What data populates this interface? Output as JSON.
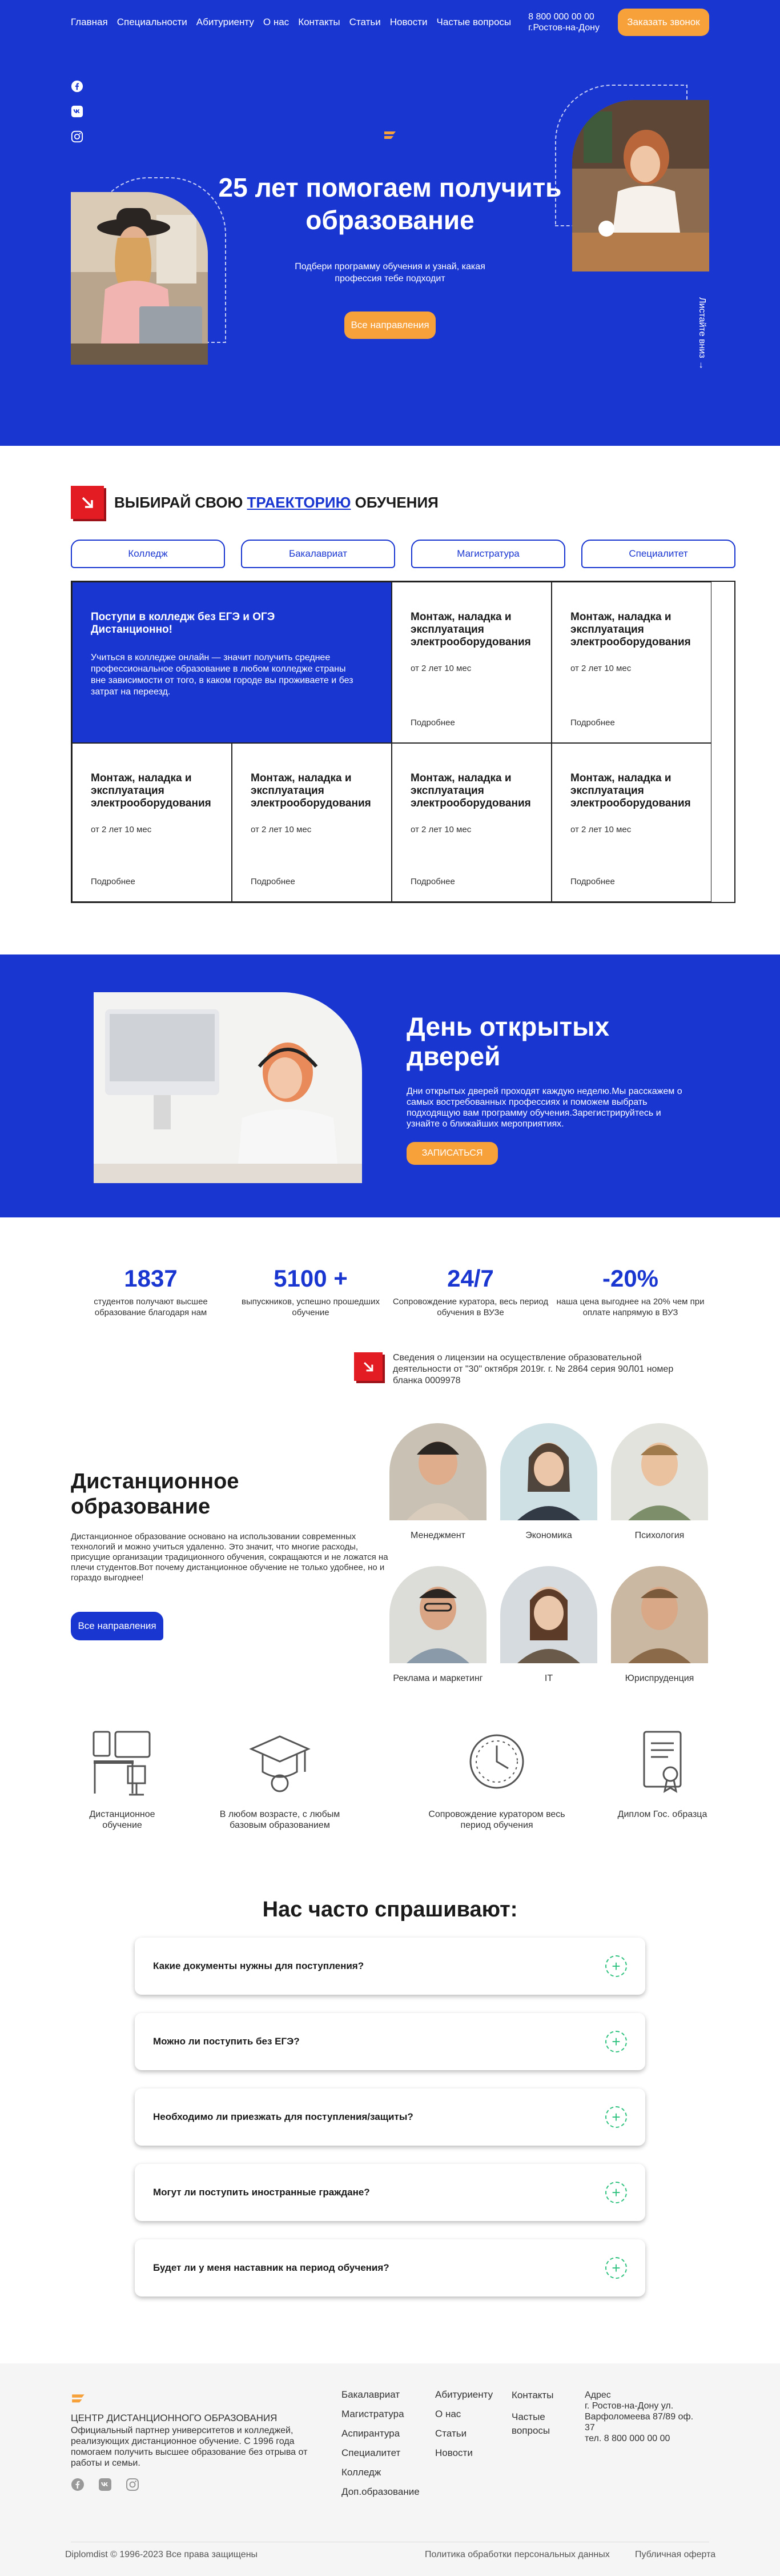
{
  "nav": {
    "links": [
      "Главная",
      "Специальности",
      "Абитуриенту",
      "О нас",
      "Контакты",
      "Статьи",
      "Новости",
      "Частые вопросы"
    ],
    "phone": "8 800 000 00 00",
    "city": "г.Ростов-на-Дону",
    "callback_label": "Заказать звонок"
  },
  "hero": {
    "title": "25 лет помогаем получить образование",
    "subtitle": "Подбери программу обучения и узнай, какая профессия тебе подходит",
    "cta_label": "Все направления",
    "scroll_hint": "Листайте вниз →",
    "socials": [
      "facebook-icon",
      "vk-icon",
      "instagram-icon"
    ]
  },
  "trajectory": {
    "title_before": "Выбирай свою ",
    "title_highlight": "траекторию",
    "title_after": " обучения",
    "tabs": [
      "Колледж",
      "Бакалавриат",
      "Магистратура",
      "Специалитет"
    ],
    "feature": {
      "title": "Поступи в колледж без ЕГЭ и ОГЭ Дистанционно!",
      "text": "Учиться в колледже онлайн — значит получить среднее профессиональное образование в любом колледже страны вне зависимости от того, в каком городе вы проживаете и без затрат на переезд."
    },
    "cards": [
      {
        "title": "Монтаж, наладка и эксплуатация электрооборудования",
        "duration": "от 2 лет 10 мес",
        "more": "Подробнее"
      },
      {
        "title": "Монтаж, наладка и эксплуатация электрооборудования",
        "duration": "от 2 лет 10 мес",
        "more": "Подробнее"
      },
      {
        "title": "Монтаж, наладка и эксплуатация электрооборудования",
        "duration": "от 2 лет 10 мес",
        "more": "Подробнее"
      },
      {
        "title": "Монтаж, наладка и эксплуатация электрооборудования",
        "duration": "от 2 лет 10 мес",
        "more": "Подробнее"
      },
      {
        "title": "Монтаж, наладка и эксплуатация электрооборудования",
        "duration": "от 2 лет 10 мес",
        "more": "Подробнее"
      },
      {
        "title": "Монтаж, наладка и эксплуатация электрооборудования",
        "duration": "от 2 лет 10 мес",
        "more": "Подробнее"
      }
    ]
  },
  "open_day": {
    "title": "День открытых дверей",
    "text": "Дни открытых дверей проходят каждую неделю.Мы расскажем о самых востребованных профессиях и поможем выбрать подходящую вам программу обучения.Зарегистрируйтесь и узнайте о ближайших мероприятиях.",
    "cta_label": "ЗАПИСАТЬСЯ"
  },
  "stats": [
    {
      "num": "1837",
      "label": "студентов получают высшее образование благодаря нам"
    },
    {
      "num": "5100 +",
      "label": "выпускников, успешно прошедших обучение"
    },
    {
      "num": "24/7",
      "label": "Сопровождение куратора, весь период обучения в ВУЗе"
    },
    {
      "num": "-20%",
      "label": "наша цена выгоднее на 20% чем при оплате напрямую в ВУЗ"
    }
  ],
  "license": "Сведения о лицензии на осуществление образовательной деятельности от \"30\" октября 2019г. г. № 2864 серия 90Л01 номер бланка 0009978",
  "distance": {
    "title": "Дистанционное образование",
    "text": "Дистанционное образование основано на использовании современных технологий и можно учиться удаленно. Это значит, что многие расходы, присущие организации традиционного обучения, сокращаются и не ложатся на плечи студентов.Вот почему дистанционное обучение не только удобнее, но и гораздо выгоднее!",
    "cta_label": "Все направления",
    "directions": [
      "Менеджмент",
      "Экономика",
      "Психология",
      "Реклама и маркетинг",
      "IT",
      "Юриспруденция"
    ]
  },
  "features": [
    "Дистанционное обучение",
    "В любом возрасте, с любым базовым образованием",
    "Сопровождение куратором весь период обучения",
    "Диплом Гос. образца"
  ],
  "faq": {
    "title": "Нас часто спрашивают:",
    "items": [
      "Какие документы нужны для поступления?",
      "Можно ли поступить без ЕГЭ?",
      "Необходимо ли приезжать для поступления/защиты?",
      "Могут ли поступить иностранные граждане?",
      "Будет ли у меня наставник на период обучения?"
    ]
  },
  "footer": {
    "brand": "ЦЕНТР ДИСТАНЦИОННОГО ОБРАЗОВАНИЯ",
    "about": "Официальный партнер университетов и колледжей, реализующих дистанционное обучение. С 1996 года помогаем получить высшее образование без отрыва от работы и семьи.",
    "col1": [
      "Бакалавриат",
      "Магистратура",
      "Аспирантура",
      "Специалитет",
      "Колледж",
      "Доп.образование"
    ],
    "col2": [
      "Абитуриенту",
      "О нас",
      "Статьи",
      "Новости"
    ],
    "col3": [
      "Контакты",
      "Частые вопросы"
    ],
    "address_title": "Адрес",
    "address": "г. Ростов-на-Дону ул. Варфоломеева 87/89 оф. 37",
    "phone": "тел. 8 800 000 00 00",
    "copyright": "Diplomdist © 1996-2023 Все права защищены",
    "privacy": "Политика обработки персональных данных",
    "offer": "Публичная оферта"
  },
  "colors": {
    "accent": "#1936d1",
    "orange": "#f7a13b",
    "red": "#e31b23",
    "green": "#2ec27e"
  }
}
